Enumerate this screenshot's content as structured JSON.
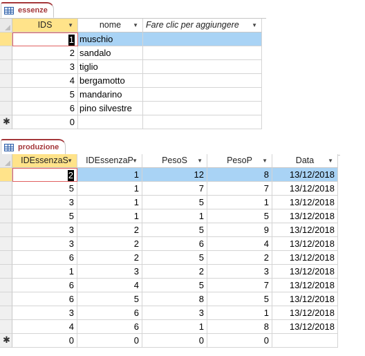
{
  "essenze": {
    "tab_label": "essenze",
    "columns": [
      "IDS",
      "nome",
      "Fare clic per aggiungere"
    ],
    "rows": [
      {
        "ids": "1",
        "nome": "muschio"
      },
      {
        "ids": "2",
        "nome": "sandalo"
      },
      {
        "ids": "3",
        "nome": "tiglio"
      },
      {
        "ids": "4",
        "nome": "bergamotto"
      },
      {
        "ids": "5",
        "nome": "mandarino"
      },
      {
        "ids": "6",
        "nome": "pino silvestre"
      }
    ],
    "new_row": {
      "ids": "0",
      "nome": ""
    }
  },
  "produzione": {
    "tab_label": "produzione",
    "columns": [
      "IDEssenzaS",
      "IDEssenzaP",
      "PesoS",
      "PesoP",
      "Data"
    ],
    "rows": [
      {
        "s": "2",
        "p": "1",
        "ps": "12",
        "pp": "8",
        "data": "13/12/2018"
      },
      {
        "s": "5",
        "p": "1",
        "ps": "7",
        "pp": "7",
        "data": "13/12/2018"
      },
      {
        "s": "3",
        "p": "1",
        "ps": "5",
        "pp": "1",
        "data": "13/12/2018"
      },
      {
        "s": "5",
        "p": "1",
        "ps": "1",
        "pp": "5",
        "data": "13/12/2018"
      },
      {
        "s": "3",
        "p": "2",
        "ps": "5",
        "pp": "9",
        "data": "13/12/2018"
      },
      {
        "s": "3",
        "p": "2",
        "ps": "6",
        "pp": "4",
        "data": "13/12/2018"
      },
      {
        "s": "6",
        "p": "2",
        "ps": "5",
        "pp": "2",
        "data": "13/12/2018"
      },
      {
        "s": "1",
        "p": "3",
        "ps": "2",
        "pp": "3",
        "data": "13/12/2018"
      },
      {
        "s": "6",
        "p": "4",
        "ps": "5",
        "pp": "7",
        "data": "13/12/2018"
      },
      {
        "s": "6",
        "p": "5",
        "ps": "8",
        "pp": "5",
        "data": "13/12/2018"
      },
      {
        "s": "3",
        "p": "6",
        "ps": "3",
        "pp": "1",
        "data": "13/12/2018"
      },
      {
        "s": "4",
        "p": "6",
        "ps": "1",
        "pp": "8",
        "data": "13/12/2018"
      }
    ],
    "new_row": {
      "s": "0",
      "p": "0",
      "ps": "0",
      "pp": "0",
      "data": ""
    }
  },
  "icons": {
    "table": "table-icon",
    "new_record": "new-record-star-icon",
    "sort": "dropdown-arrow-icon"
  },
  "colors": {
    "tab_text": "#a4373a",
    "selected_row": "#a9d3f5",
    "active_header": "#ffe38a"
  }
}
